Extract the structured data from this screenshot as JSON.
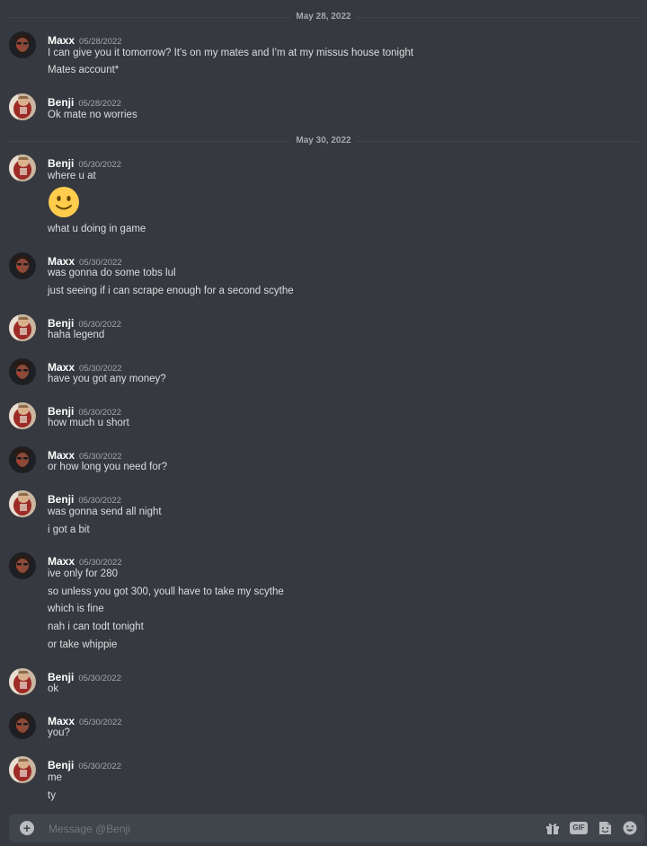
{
  "dividers": [
    {
      "label": "May 28, 2022"
    },
    {
      "label": "May 30, 2022"
    }
  ],
  "groups": [
    {
      "author": "Maxx",
      "timestamp": "05/28/2022",
      "lines": [
        "I can give you it tomorrow? It's on my mates and I'm at my missus house tonight",
        "Mates account*"
      ]
    },
    {
      "author": "Benji",
      "timestamp": "05/28/2022",
      "lines": [
        "Ok mate no worries"
      ]
    },
    {
      "author": "Benji",
      "timestamp": "05/30/2022",
      "lines": [
        "where u at",
        "what u doing in game"
      ],
      "emoji": "slightly-smiling-face"
    },
    {
      "author": "Maxx",
      "timestamp": "05/30/2022",
      "lines": [
        "was gonna do some tobs lul",
        "just seeing if i can scrape enough for a second scythe"
      ]
    },
    {
      "author": "Benji",
      "timestamp": "05/30/2022",
      "lines": [
        "haha legend"
      ]
    },
    {
      "author": "Maxx",
      "timestamp": "05/30/2022",
      "lines": [
        "have you got any money?"
      ]
    },
    {
      "author": "Benji",
      "timestamp": "05/30/2022",
      "lines": [
        "how much u short"
      ]
    },
    {
      "author": "Maxx",
      "timestamp": "05/30/2022",
      "lines": [
        "or how long you need for?"
      ]
    },
    {
      "author": "Benji",
      "timestamp": "05/30/2022",
      "lines": [
        "was gonna send all night",
        "i got a bit"
      ]
    },
    {
      "author": "Maxx",
      "timestamp": "05/30/2022",
      "lines": [
        "ive only for 280",
        "so unless you got 300, youll have to take my scythe",
        "which is fine",
        "nah i can todt tonight",
        "or take whippie"
      ]
    },
    {
      "author": "Benji",
      "timestamp": "05/30/2022",
      "lines": [
        "ok"
      ]
    },
    {
      "author": "Maxx",
      "timestamp": "05/30/2022",
      "lines": [
        "you?"
      ]
    },
    {
      "author": "Benji",
      "timestamp": "05/30/2022",
      "lines": [
        "me",
        "ty"
      ]
    }
  ],
  "composer": {
    "placeholder": "Message @Benji",
    "icons": [
      "add-attachment-icon",
      "gift-icon",
      "gif-icon",
      "sticker-icon",
      "emoji-icon"
    ],
    "gif_label": "GIF"
  },
  "colors": {
    "background": "#36393f",
    "composer": "#40444b",
    "text": "#dcddde",
    "muted": "#a3a6aa"
  }
}
